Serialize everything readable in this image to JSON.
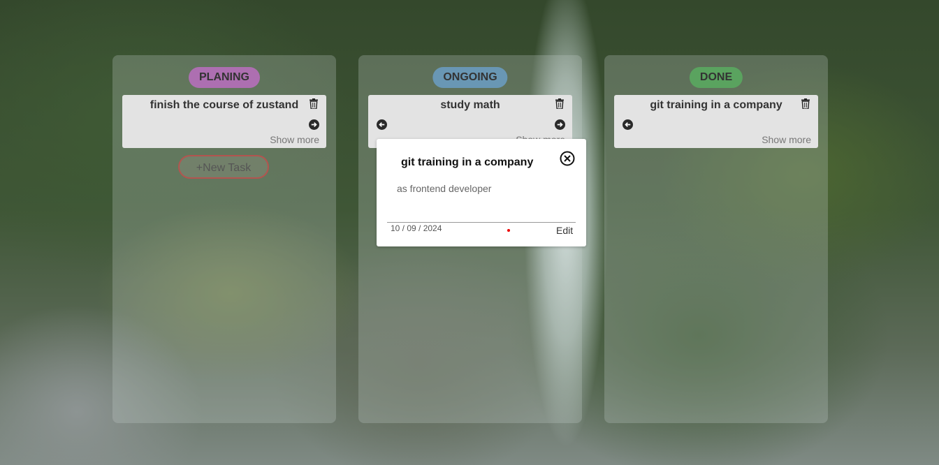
{
  "colors": {
    "planing": "#bb6fbf",
    "ongoing": "#6b9ec4",
    "done": "#5aa85f"
  },
  "columns": [
    {
      "title": "PLANING",
      "card": {
        "title": "finish the course of zustand",
        "show_more": "Show more"
      },
      "new_task": "+New Task"
    },
    {
      "title": "ONGOING",
      "card": {
        "title": "study math",
        "show_more": "Show more"
      }
    },
    {
      "title": "DONE",
      "card": {
        "title": "git training in a company",
        "show_more": "Show more"
      }
    }
  ],
  "modal": {
    "title": "git training in a company",
    "description": "as frontend developer",
    "date": "10 / 09 / 2024",
    "edit": "Edit"
  },
  "icons": [
    "trash-icon",
    "arrow-left-icon",
    "arrow-right-icon",
    "close-icon"
  ]
}
